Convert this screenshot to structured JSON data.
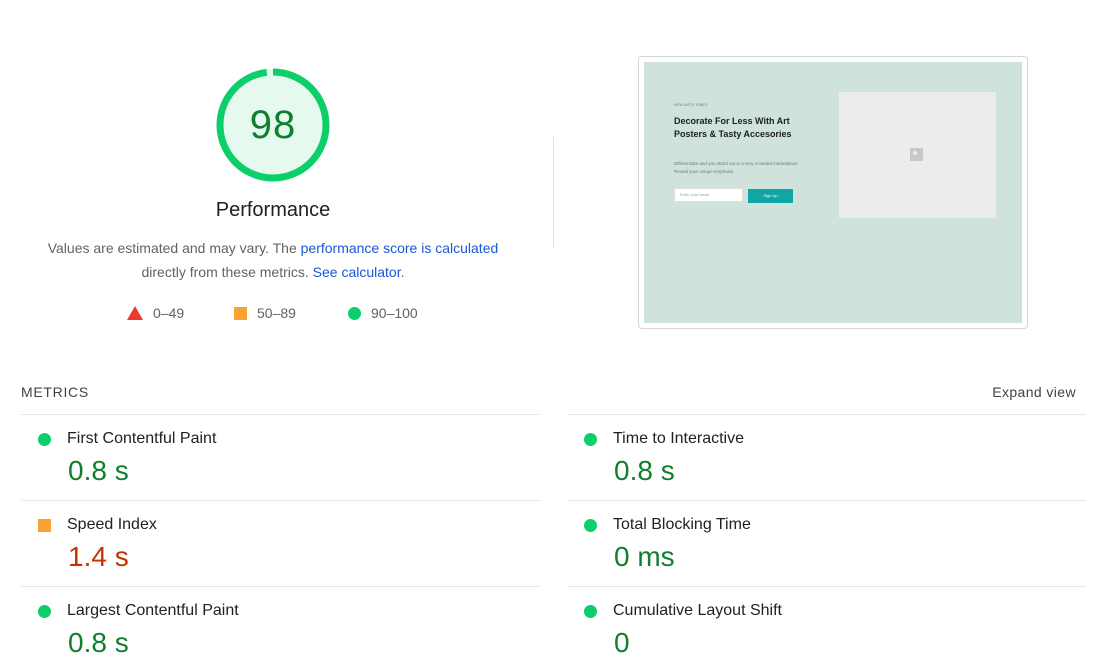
{
  "score": {
    "value": "98",
    "fraction": 0.98,
    "color": "#0cce6b"
  },
  "performance": {
    "title": "Performance",
    "desc_pre": "Values are estimated and may vary. The ",
    "desc_link": "performance score is calculated",
    "desc_mid": " directly from these metrics. ",
    "calc_link": "See calculator",
    "desc_end": "."
  },
  "legend": {
    "fail": "0–49",
    "average": "50–89",
    "pass": "90–100"
  },
  "screenshot": {
    "eyebrow": "NEW ARTS VIBES",
    "heading": "Decorate For Less With Art Posters & Tasty Accesories",
    "text": "Differentiate and you stand out in a very crowded marketplace. Reveal your unique emphasis",
    "input_placeholder": "Enter your email",
    "button": "Sign Up"
  },
  "metrics_header": "METRICS",
  "expand_label": "Expand view",
  "metrics": {
    "fcp": {
      "title": "First Contentful Paint",
      "value": "0.8 s",
      "status": "pass"
    },
    "si": {
      "title": "Speed Index",
      "value": "1.4 s",
      "status": "average"
    },
    "lcp": {
      "title": "Largest Contentful Paint",
      "value": "0.8 s",
      "status": "pass"
    },
    "tti": {
      "title": "Time to Interactive",
      "value": "0.8 s",
      "status": "pass"
    },
    "tbt": {
      "title": "Total Blocking Time",
      "value": "0 ms",
      "status": "pass"
    },
    "cls": {
      "title": "Cumulative Layout Shift",
      "value": "0",
      "status": "pass"
    }
  },
  "colors": {
    "pass": "#0cce6b",
    "pass_text": "#0f7f2e",
    "average": "#f7a233",
    "average_text": "#c33300",
    "fail": "#eb3b31",
    "link": "#1a57d6"
  }
}
